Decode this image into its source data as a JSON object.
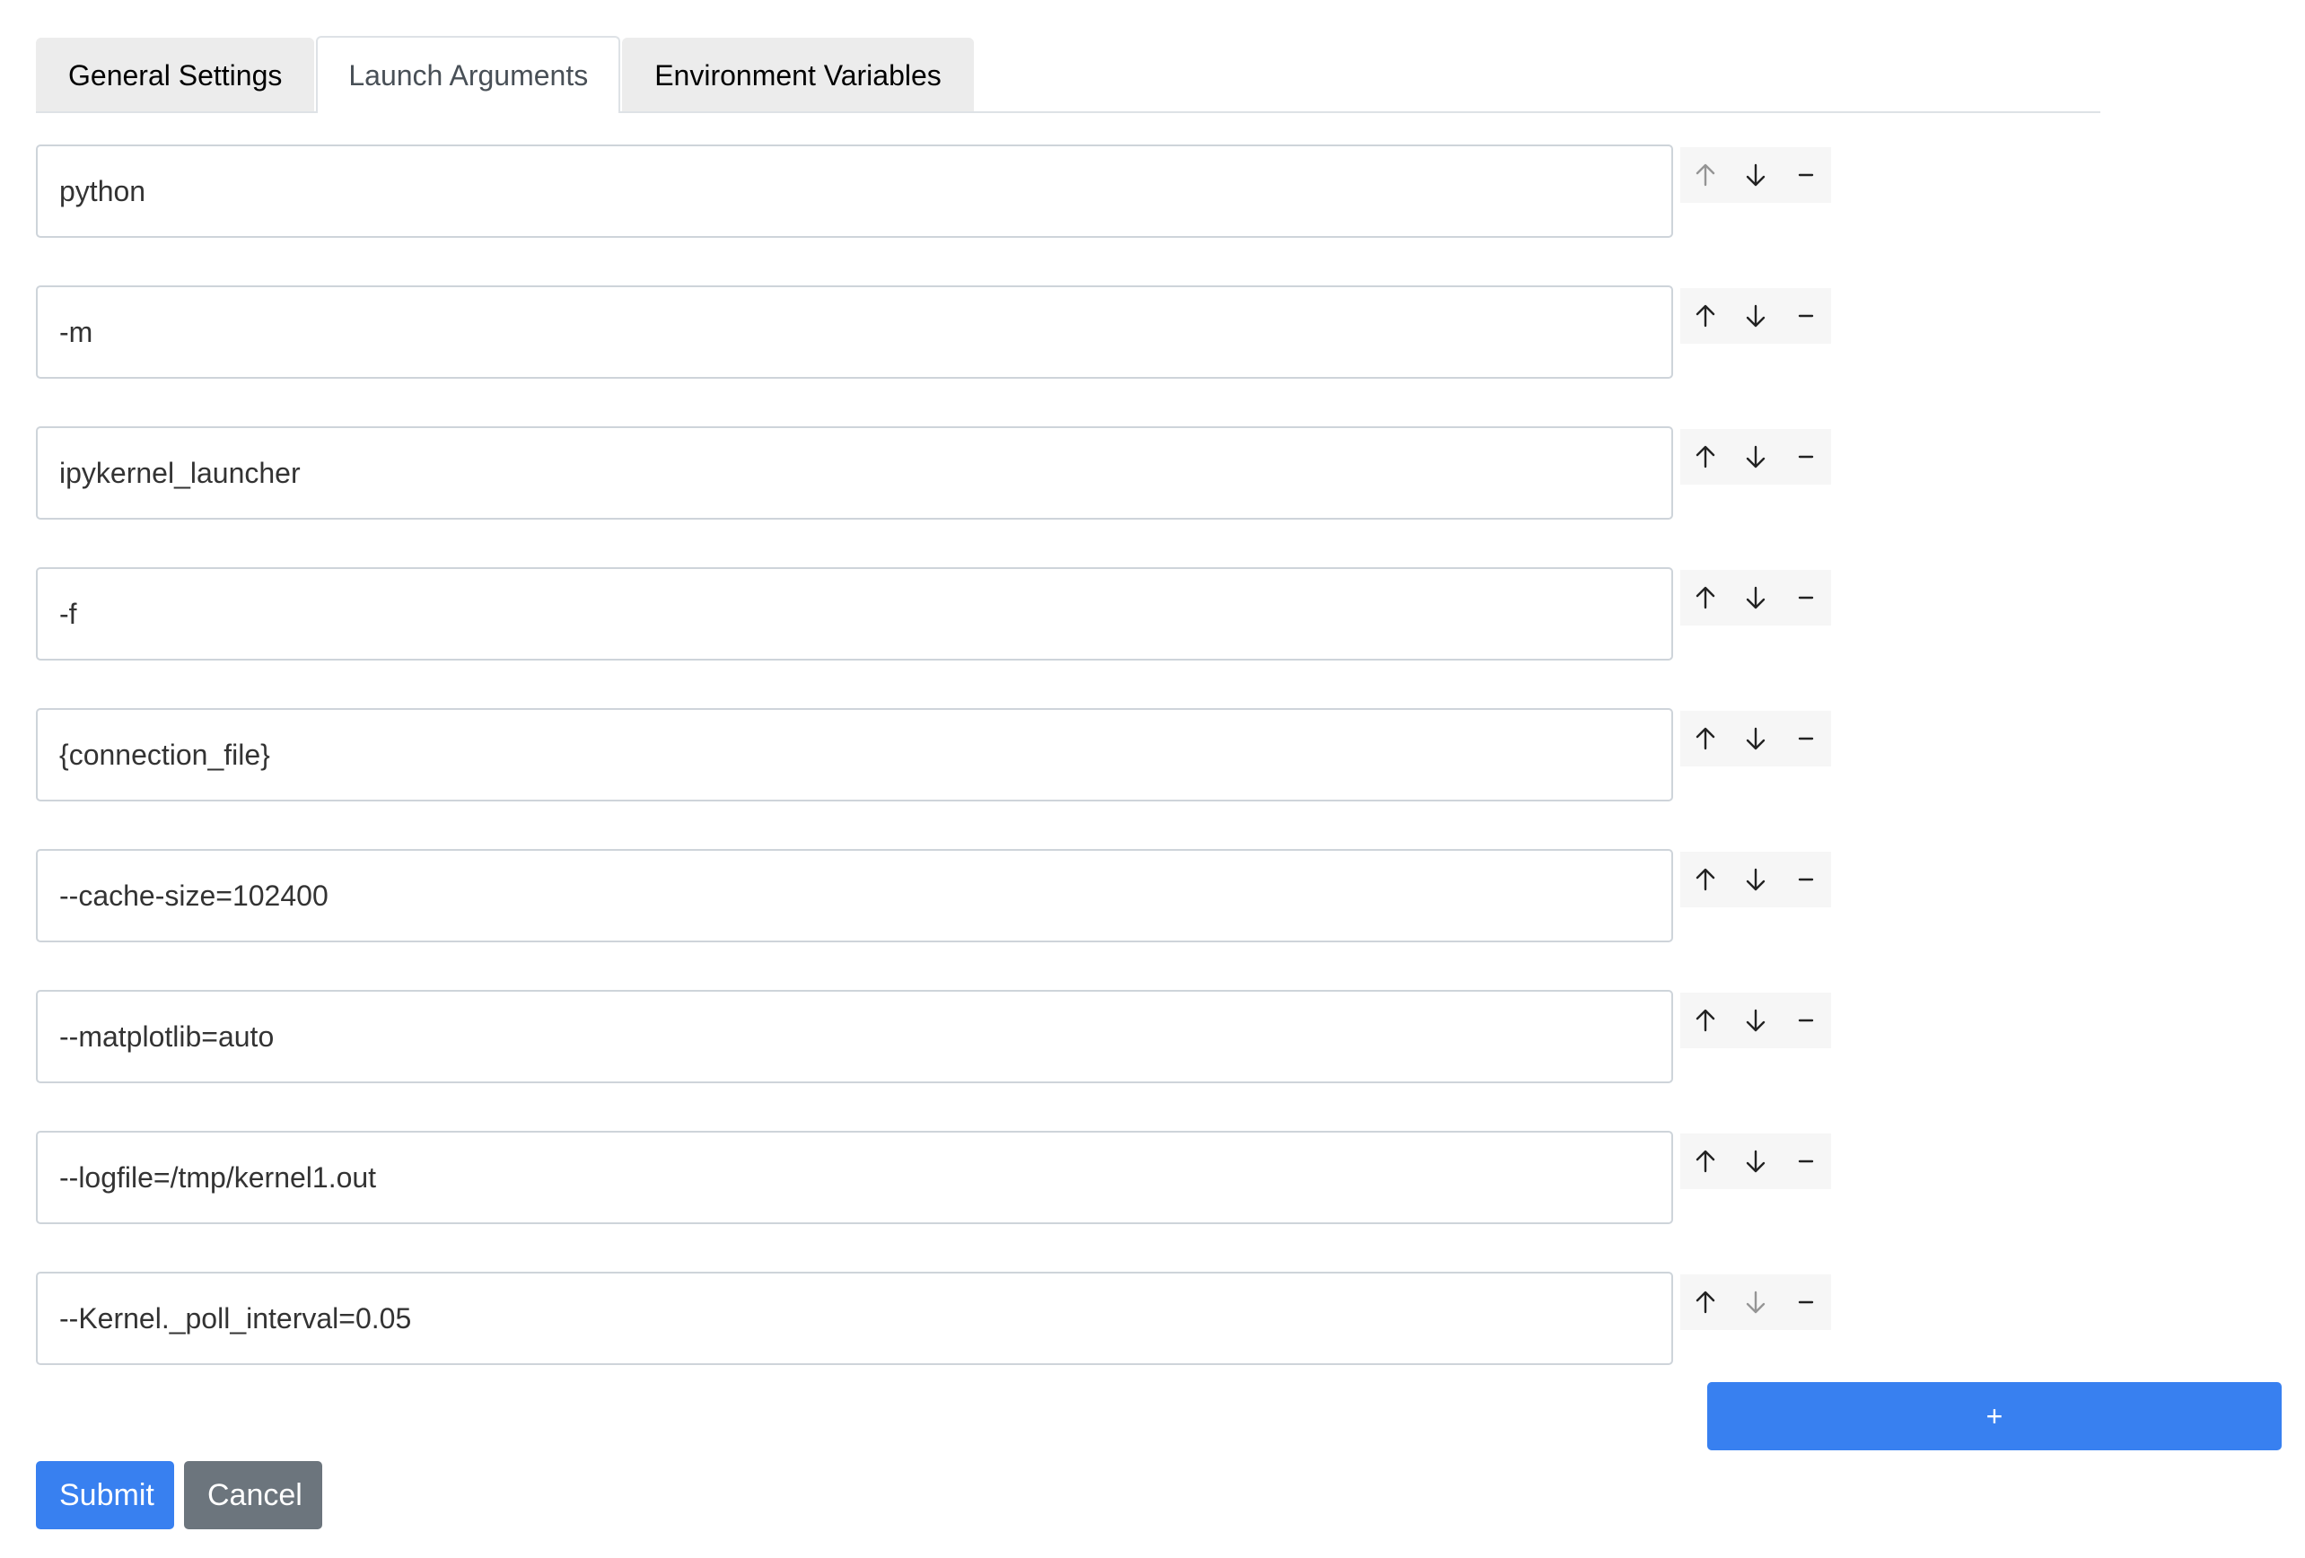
{
  "tabs": [
    {
      "label": "General Settings",
      "active": false
    },
    {
      "label": "Launch Arguments",
      "active": true
    },
    {
      "label": "Environment Variables",
      "active": false
    }
  ],
  "arguments": [
    {
      "value": "python",
      "up_enabled": false,
      "down_enabled": true
    },
    {
      "value": "-m",
      "up_enabled": true,
      "down_enabled": true
    },
    {
      "value": "ipykernel_launcher",
      "up_enabled": true,
      "down_enabled": true
    },
    {
      "value": "-f",
      "up_enabled": true,
      "down_enabled": true
    },
    {
      "value": "{connection_file}",
      "up_enabled": true,
      "down_enabled": true
    },
    {
      "value": "--cache-size=102400",
      "up_enabled": true,
      "down_enabled": true
    },
    {
      "value": "--matplotlib=auto",
      "up_enabled": true,
      "down_enabled": true
    },
    {
      "value": "--logfile=/tmp/kernel1.out",
      "up_enabled": true,
      "down_enabled": true
    },
    {
      "value": "--Kernel._poll_interval=0.05",
      "up_enabled": true,
      "down_enabled": false
    }
  ],
  "row_icons": {
    "up": "arrow-up-icon",
    "down": "arrow-down-icon",
    "remove": "minus-icon"
  },
  "add_button": {
    "label": "+"
  },
  "footer": {
    "submit_label": "Submit",
    "cancel_label": "Cancel"
  },
  "colors": {
    "primary": "#3880f0",
    "secondary": "#6c757d",
    "tab_inactive_bg": "#ececec"
  }
}
